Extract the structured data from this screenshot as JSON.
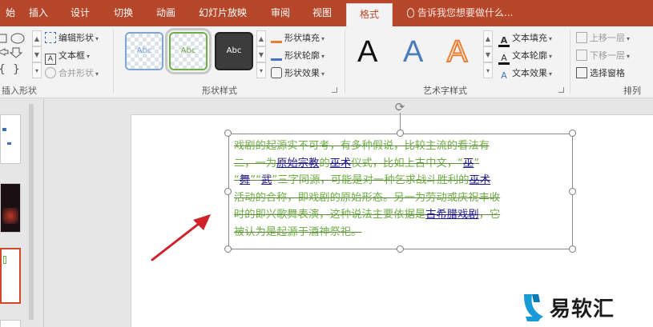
{
  "tabs": [
    "始",
    "插入",
    "设计",
    "切换",
    "动画",
    "幻灯片放映",
    "审阅",
    "视图",
    "格式"
  ],
  "active_tab": "格式",
  "tell_me": "告诉我您想要做什么...",
  "insert_shapes": {
    "edit_shape": "编辑形状",
    "text_box": "文本框",
    "merge_shapes": "合并形状",
    "label": "插入形状"
  },
  "shape_styles": {
    "samples": [
      "Abc",
      "Abc",
      "Abc"
    ],
    "fill": "形状填充",
    "outline": "形状轮廓",
    "effects": "形状效果",
    "label": "形状样式"
  },
  "wordart": {
    "samples": [
      "A",
      "A",
      "A"
    ],
    "text_fill": "文本填充",
    "text_outline": "文本轮廓",
    "text_effects": "文本效果",
    "label": "艺术字样式"
  },
  "arrange": {
    "bring_forward": "上移一层",
    "send_backward": "下移一层",
    "selection_pane": "选择窗格",
    "label": "排列"
  },
  "slide_text": {
    "line1": "戏剧的起源实不可考，有多种假说，比较主流的看法有",
    "line2_a": "二，一为",
    "line2_link1": "原始宗教",
    "line2_b": "的",
    "line2_link2": "巫术",
    "line2_c": "仪式，比如上古中文，“",
    "line2_link3": "巫",
    "line2_d": "”",
    "line3_a": "“",
    "line3_link1": "舞",
    "line3_b": "”“",
    "line3_link2": "武",
    "line3_c": "”三字同源，可能是对一种乞求战斗胜利的",
    "line3_link3": "巫术",
    "line4": "活动的合称，即戏剧的原始形态。另一为劳动或庆祝丰收",
    "line5_a": "时的即兴歌舞表演，这种说法主要依据是",
    "line5_link": "古希腊戏剧",
    "line5_b": "，它",
    "line6": "被认为是起源于酒神祭祀。"
  },
  "watermark": "易软汇",
  "colors": {
    "accent": "#b7472a",
    "text_green": "#70ad47",
    "link_blue": "#1f1a8a",
    "arrow_red": "#d0202a"
  }
}
